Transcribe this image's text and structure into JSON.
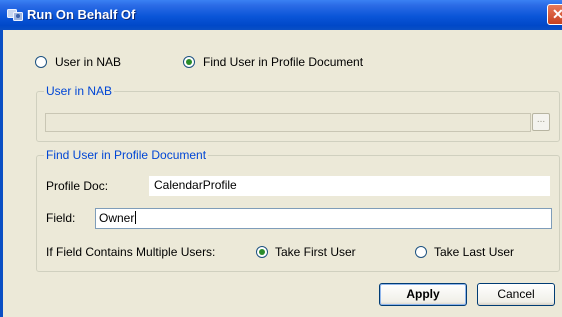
{
  "window": {
    "title": "Run On Behalf Of",
    "close_symbol": "✕"
  },
  "mode_options": [
    {
      "label": "User in NAB",
      "selected": false
    },
    {
      "label": "Find User in Profile Document",
      "selected": true
    }
  ],
  "nab_group": {
    "legend": "User in NAB",
    "field_value": "",
    "browse_label": "..."
  },
  "profile_group": {
    "legend": "Find User in Profile Document",
    "profile_doc_label": "Profile Doc:",
    "profile_doc_value": "CalendarProfile",
    "field_label": "Field:",
    "field_value": "Owner",
    "multi_users_label": "If Field Contains Multiple Users:",
    "multi_user_options": [
      {
        "label": "Take First User",
        "selected": true
      },
      {
        "label": "Take Last User",
        "selected": false
      }
    ]
  },
  "buttons": {
    "apply": "Apply",
    "cancel": "Cancel"
  },
  "colors": {
    "title_bar": "#0a55d8",
    "group_legend": "#0046d5",
    "dialog_bg": "#ece9d8"
  },
  "icons": {
    "title": "run-on-behalf-icon",
    "close": "close-icon"
  }
}
